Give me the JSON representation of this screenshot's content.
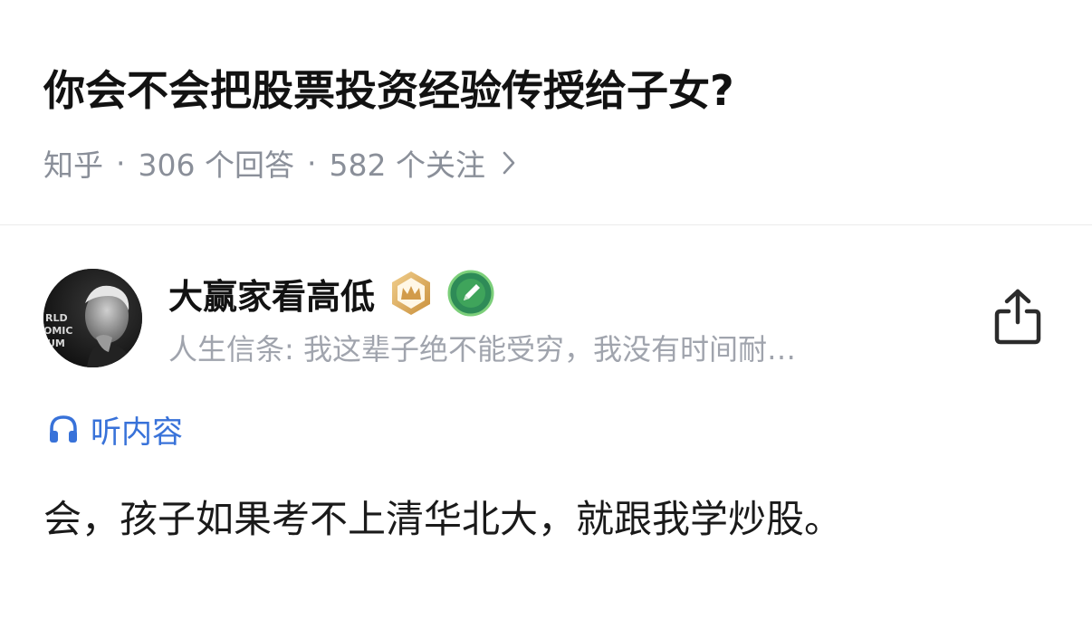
{
  "question": {
    "title": "你会不会把股票投资经验传授给子女?"
  },
  "meta": {
    "source": "知乎",
    "separator": "·",
    "answers": "306 个回答",
    "followers": "582 个关注",
    "chevron_icon": "chevron-right-icon"
  },
  "author": {
    "name": "大赢家看高低",
    "bio": "人生信条: 我这辈子绝不能受穷，我没有时间耐…",
    "avatar_text": [
      "RLD",
      "OMIC",
      "UM"
    ],
    "badges": [
      "crown-badge-icon",
      "pencil-badge-icon"
    ]
  },
  "share": {
    "icon": "share-icon"
  },
  "listen": {
    "label": "听内容",
    "icon": "headphones-icon",
    "color": "#3872d9"
  },
  "answer": {
    "text": "会，孩子如果考不上清华北大，就跟我学炒股。"
  }
}
